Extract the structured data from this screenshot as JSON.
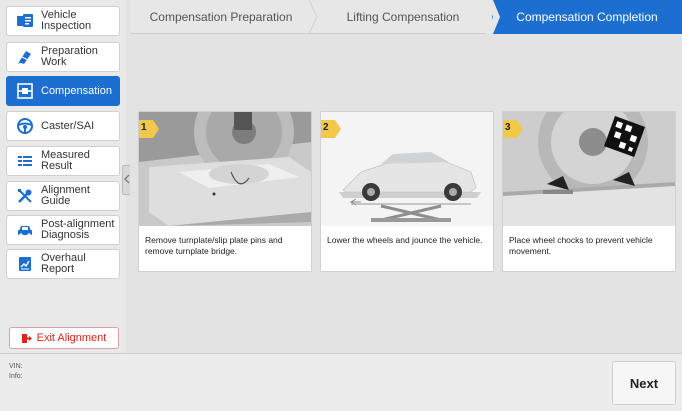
{
  "sidebar": {
    "items": [
      {
        "label": "Vehicle\nInspection",
        "icon": "vehicle-inspection-icon"
      },
      {
        "label": "Preparation\nWork",
        "icon": "preparation-icon"
      },
      {
        "label": "Compensation",
        "icon": "compensation-icon",
        "active": true
      },
      {
        "label": "Caster/SAI",
        "icon": "steering-wheel-icon"
      },
      {
        "label": "Measured\nResult",
        "icon": "measured-result-icon"
      },
      {
        "label": "Alignment\nGuide",
        "icon": "tools-icon"
      },
      {
        "label": "Post-alignment\nDiagnosis",
        "icon": "car-icon"
      },
      {
        "label": "Overhaul Report",
        "icon": "report-icon"
      }
    ],
    "exit_label": "Exit Alignment"
  },
  "tabs": [
    {
      "label": "Compensation Preparation"
    },
    {
      "label": "Lifting Compensation"
    },
    {
      "label": "Compensation Completion",
      "active": true
    }
  ],
  "cards": [
    {
      "num": "1",
      "desc": "Remove turnplate/slip plate pins and remove turnplate bridge."
    },
    {
      "num": "2",
      "desc": "Lower the wheels and jounce the vehicle."
    },
    {
      "num": "3",
      "desc": "Place wheel chocks to prevent vehicle movement."
    }
  ],
  "bottom": {
    "vin_label": "VIN:",
    "info_label": "Info:",
    "next_label": "Next"
  },
  "colors": {
    "accent": "#1c6fd1",
    "exit": "#e2231a",
    "badge": "#f2c84b"
  }
}
